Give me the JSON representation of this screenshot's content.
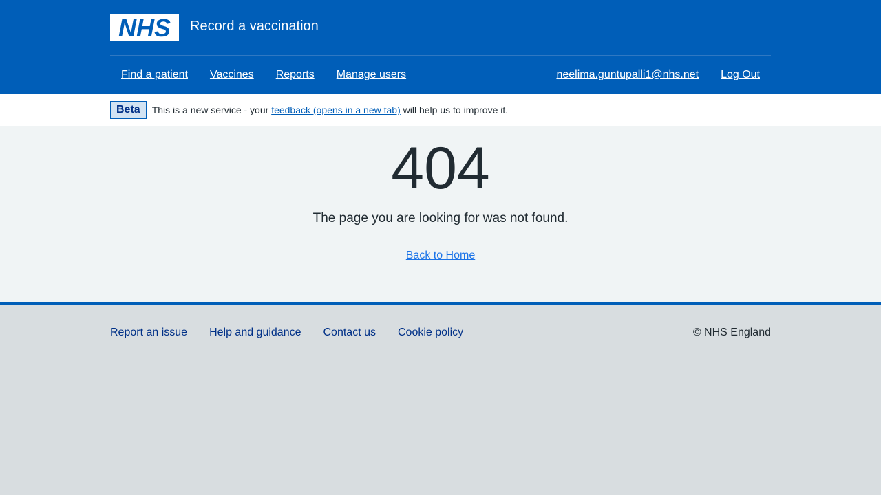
{
  "header": {
    "logo_text": "NHS",
    "service_name": "Record a vaccination",
    "nav_left": [
      {
        "label": "Find a patient"
      },
      {
        "label": "Vaccines"
      },
      {
        "label": "Reports"
      },
      {
        "label": "Manage users"
      }
    ],
    "nav_right": [
      {
        "label": "neelima.guntupalli1@nhs.net"
      },
      {
        "label": "Log Out"
      }
    ]
  },
  "phase_banner": {
    "tag": "Beta",
    "text_before": "This is a new service - your ",
    "link": "feedback (opens in a new tab)",
    "text_after": " will help us to improve it."
  },
  "main": {
    "error_code": "404",
    "message": "The page you are looking for was not found.",
    "back_link": "Back to Home"
  },
  "footer": {
    "links": [
      {
        "label": "Report an issue"
      },
      {
        "label": "Help and guidance"
      },
      {
        "label": "Contact us"
      },
      {
        "label": "Cookie policy"
      }
    ],
    "copyright": "© NHS England"
  },
  "colors": {
    "brand_blue": "#005eb8",
    "page_background": "#f0f4f5",
    "footer_background": "#d8dde0",
    "link_blue": "#1a73e8",
    "footer_link": "#003087"
  },
  "icons": {
    "logo": "nhs-logo-icon"
  }
}
